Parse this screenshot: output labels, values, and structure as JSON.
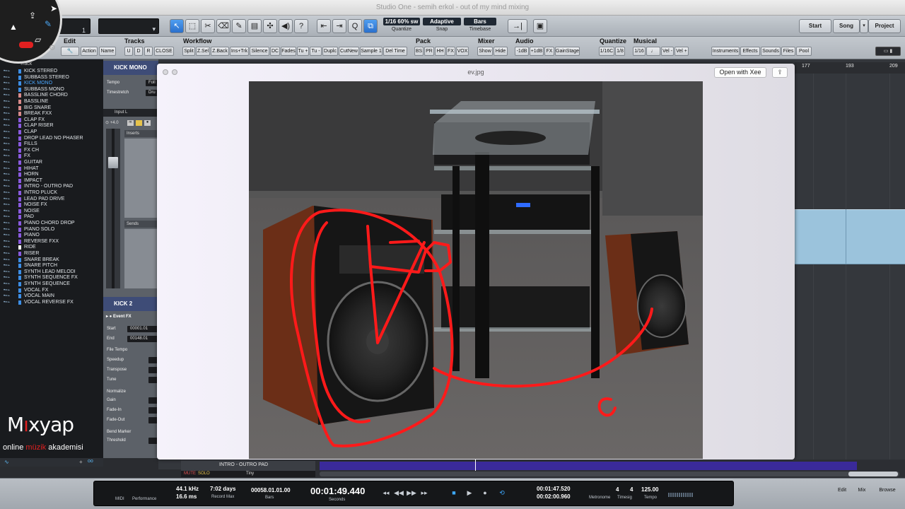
{
  "window": {
    "title": "Studio One - semih erkol - out of my mind mixing"
  },
  "toolbar": {
    "track_number": "1",
    "quantize_value": "1/16 60% sw",
    "quantize_label": "Quantize",
    "snap_value": "Adaptive",
    "snap_label": "Snap",
    "timebase_value": "Bars",
    "timebase_label": "Timebase",
    "start": "Start",
    "song": "Song",
    "project": "Project"
  },
  "macro_groups": {
    "edit": {
      "label": "Edit",
      "buttons": [
        "Action",
        "Name"
      ]
    },
    "tracks": {
      "label": "Tracks",
      "buttons": [
        "U",
        "D",
        "R",
        "CLOSE"
      ]
    },
    "workflow": {
      "label": "Workflow",
      "buttons": [
        "Split",
        "Z.Sel",
        "Z.Back",
        "Ins+Trk",
        "Silence",
        "DC",
        "Fades",
        "Tu +",
        "Tu -",
        "Duplc",
        "CutNew",
        "Sample 1",
        "Del Time"
      ]
    },
    "pack": {
      "label": "Pack",
      "buttons": [
        "BS",
        "PR",
        "HH",
        "FX",
        "VOX"
      ]
    },
    "mixer": {
      "label": "Mixer",
      "buttons": [
        "Show",
        "Hide"
      ]
    },
    "audio": {
      "label": "Audio",
      "buttons": [
        "-1dB",
        "+1dB",
        "FX",
        "GainStage"
      ]
    },
    "quantize": {
      "label": "Quantize",
      "buttons": [
        "1/16C",
        "1/8"
      ]
    },
    "musical": {
      "label": "Musical",
      "buttons": [
        "1/16",
        "Vel -",
        "Vel +"
      ]
    },
    "browser": {
      "buttons": [
        "Instruments",
        "Effects",
        "Sounds",
        "Files",
        "Pool"
      ]
    }
  },
  "tracklist": {
    "header": "Track",
    "tracks": [
      {
        "name": "KICK STEREO",
        "color": "#3c8ee6"
      },
      {
        "name": "SUBBASS STEREO",
        "color": "#3c8ee6"
      },
      {
        "name": "KICK MONO",
        "color": "#3c8ee6",
        "selected": true
      },
      {
        "name": "SUBBASS MONO",
        "color": "#3c8ee6"
      },
      {
        "name": "BASSLINE CHORD",
        "color": "#d88a8a"
      },
      {
        "name": "BASSLINE",
        "color": "#d88a8a"
      },
      {
        "name": "BIG SNARE",
        "color": "#d88a8a"
      },
      {
        "name": "BREAK FXX",
        "color": "#d88a8a"
      },
      {
        "name": "CLAP FX",
        "color": "#8a5ae0"
      },
      {
        "name": "CLAP RISER",
        "color": "#8a5ae0"
      },
      {
        "name": "CLAP",
        "color": "#8a5ae0"
      },
      {
        "name": "DROP LEAD NO PHASER",
        "color": "#8a5ae0"
      },
      {
        "name": "FILLS",
        "color": "#8a5ae0"
      },
      {
        "name": "FX CH",
        "color": "#8a5ae0"
      },
      {
        "name": "FX",
        "color": "#8a5ae0"
      },
      {
        "name": "GUITAR",
        "color": "#8a5ae0"
      },
      {
        "name": "HIHAT",
        "color": "#8a5ae0"
      },
      {
        "name": "HORN",
        "color": "#8a5ae0"
      },
      {
        "name": "IMPACT",
        "color": "#8a5ae0"
      },
      {
        "name": "INTRO - OUTRO PAD",
        "color": "#8a5ae0"
      },
      {
        "name": "INTRO PLUCK",
        "color": "#8a5ae0"
      },
      {
        "name": "LEAD PAD DRIVE",
        "color": "#8a5ae0"
      },
      {
        "name": "NOISE FX",
        "color": "#8a5ae0"
      },
      {
        "name": "NOISE",
        "color": "#8a5ae0"
      },
      {
        "name": "PAD",
        "color": "#8a5ae0"
      },
      {
        "name": "PIANO CHORD DROP",
        "color": "#8a5ae0"
      },
      {
        "name": "PIANO SOLO",
        "color": "#8a5ae0"
      },
      {
        "name": "PIANO",
        "color": "#8a5ae0"
      },
      {
        "name": "REVERSE FXX",
        "color": "#8a5ae0"
      },
      {
        "name": "RIDE",
        "color": "#ffffff"
      },
      {
        "name": "RISER",
        "color": "#8a5ae0"
      },
      {
        "name": "SNARE BREAK",
        "color": "#3c8ee6"
      },
      {
        "name": "SNARE PITCH",
        "color": "#3c8ee6"
      },
      {
        "name": "SYNTH LEAD MELODI",
        "color": "#3c8ee6"
      },
      {
        "name": "SYNTH SEQUENCE FX",
        "color": "#3c8ee6"
      },
      {
        "name": "SYNTH SEQUENCE",
        "color": "#3c8ee6"
      },
      {
        "name": "VOCAL FX",
        "color": "#3c8ee6"
      },
      {
        "name": "VOCAL MAIN",
        "color": "#3c8ee6"
      },
      {
        "name": "VOCAL REVERSE FX",
        "color": "#3c8ee6"
      }
    ]
  },
  "inspector": {
    "track_name": "KICK MONO",
    "tempo_label": "Tempo",
    "tempo_value": "Foll",
    "timestretch_label": "Timestretch",
    "timestretch_value": "Dru",
    "input_label": "Input L",
    "volume": "+4.0",
    "inserts_label": "Inserts",
    "sends_label": "Sends",
    "event_track": "KICK 2",
    "event_fx": "Event FX",
    "start_label": "Start",
    "start_value": "00001.01",
    "end_label": "End",
    "end_value": "00148.01",
    "file_tempo": "File Tempo",
    "speedup": "Speedup",
    "transpose": "Transpose",
    "tune": "Tune",
    "normalize": "Normalize",
    "gain": "Gain",
    "fade_in": "Fade-In",
    "fade_out": "Fade-Out",
    "bend_marker": "Bend Marker",
    "threshold": "Threshold"
  },
  "ruler": {
    "bars": [
      "177",
      "193",
      "209"
    ]
  },
  "viewer": {
    "title": "ev.jpg",
    "open_with": "Open with Xee",
    "annotation_letter": "C"
  },
  "track_strip": {
    "name": "INTRO - OUTRO PAD",
    "mute": "MUTE",
    "solo": "SOLO",
    "size": "Tiny"
  },
  "transport": {
    "midi": "MIDI",
    "performance": "Performance",
    "sample_rate": "44.1 kHz",
    "latency": "16.6 ms",
    "record_max": "7:02 days",
    "record_max_label": "Record Max",
    "bars_pos": "00058.01.01.00",
    "bars_label": "Bars",
    "seconds": "00:01:49.440",
    "seconds_label": "Seconds",
    "loop_start": "00:01:47.520",
    "loop_end": "00:02:00.960",
    "metronome": "Metronome",
    "timesig_num": "4",
    "timesig_den": "4",
    "timesig_label": "Timesig",
    "tempo": "125.00",
    "tempo_label": "Tempo",
    "edit": "Edit",
    "mix": "Mix",
    "browse": "Browse"
  },
  "logo": {
    "brand_red": "ı",
    "brand_rest": "xyap",
    "tagline_1": "online ",
    "tagline_red": "müzik",
    "tagline_2": " akademisi"
  }
}
